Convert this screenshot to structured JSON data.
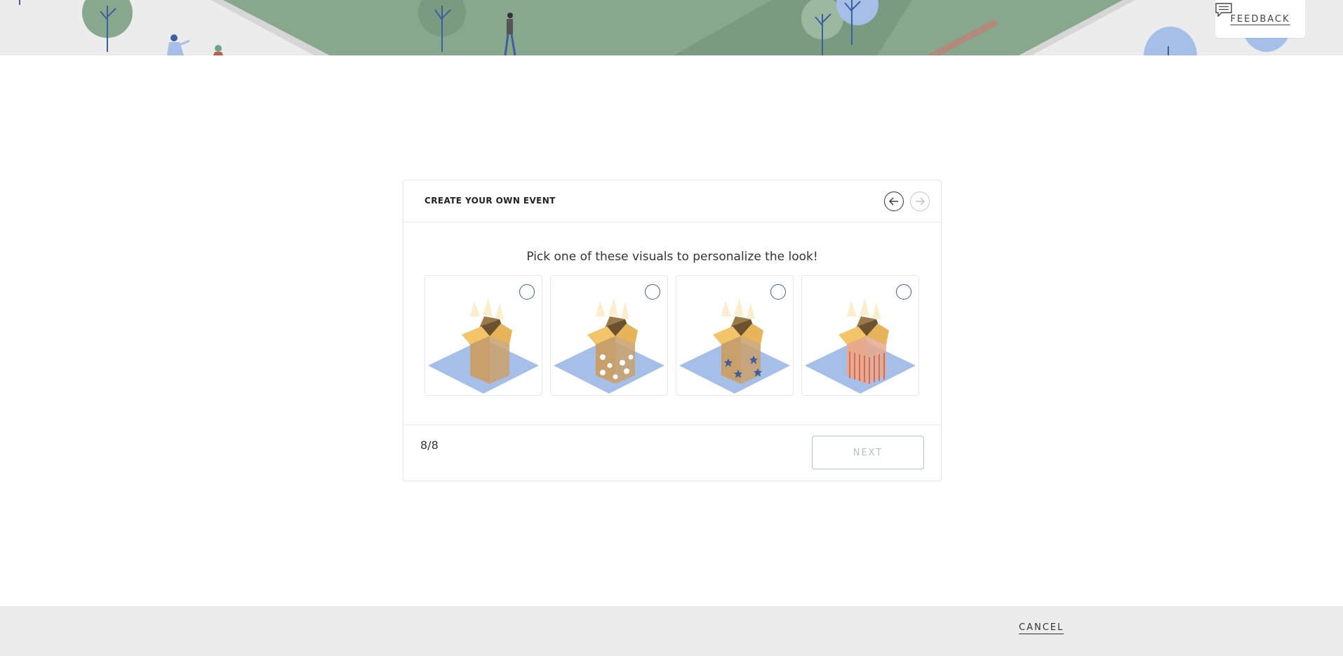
{
  "header": {
    "feedback_label": "FEEDBACK"
  },
  "wizard": {
    "title": "CREATE YOUR OWN EVENT",
    "prompt": "Pick one of these visuals to personalize the look!",
    "progress": "8/8",
    "next_label": "NEXT",
    "options": [
      {
        "pattern": "plain",
        "box_color": "#c9a06b",
        "selected": false
      },
      {
        "pattern": "dots",
        "box_color": "#c9a06b",
        "selected": false
      },
      {
        "pattern": "stars",
        "box_color": "#c9a06b",
        "selected": false
      },
      {
        "pattern": "stripes",
        "box_color": "#e8a98c",
        "selected": false
      }
    ]
  },
  "footer": {
    "cancel_label": "CANCEL"
  },
  "colors": {
    "accent": "#3d5f9d",
    "banner_bg": "#ececec",
    "hill_green": "#88a88e",
    "tree_blue": "#a6bfe8",
    "floor_blue": "#a6bfe8"
  }
}
